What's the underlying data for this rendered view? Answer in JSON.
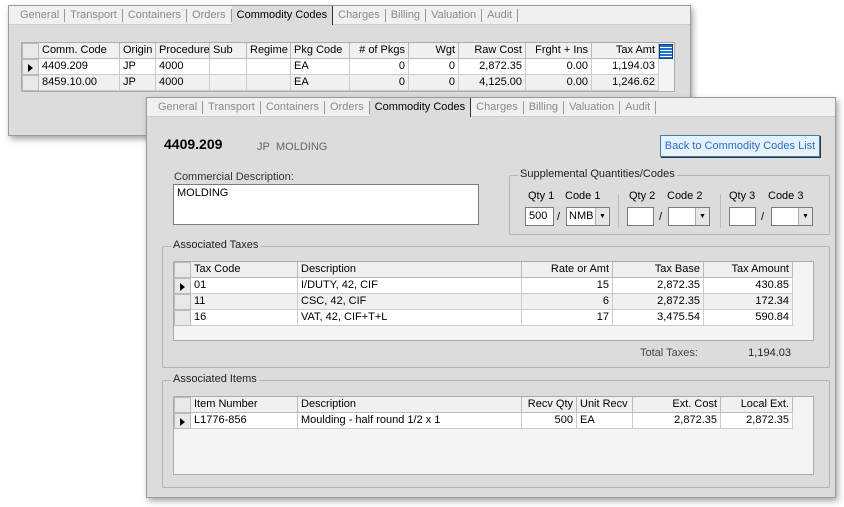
{
  "tabs": [
    "General",
    "Transport",
    "Containers",
    "Orders",
    "Commodity Codes",
    "Charges",
    "Billing",
    "Valuation",
    "Audit"
  ],
  "active_tab": "Commodity Codes",
  "list_grid": {
    "columns": [
      "Comm. Code",
      "Origin",
      "Procedure",
      "Sub",
      "Regime",
      "Pkg Code",
      "# of Pkgs",
      "Wgt",
      "Raw Cost",
      "Frght + Ins",
      "Tax Amt"
    ],
    "rows": [
      [
        "4409.209",
        "JP",
        "4000",
        "",
        "",
        "EA",
        "0",
        "0",
        "2,872.35",
        "0.00",
        "1,194.03"
      ],
      [
        "8459.10.00",
        "JP",
        "4000",
        "",
        "",
        "EA",
        "0",
        "0",
        "4,125.00",
        "0.00",
        "1,246.62"
      ]
    ],
    "menu_icon": "column-chooser-icon"
  },
  "detail": {
    "code": "4409.209",
    "origin": "JP",
    "name": "MOLDING",
    "back_button": "Back to Commodity Codes List",
    "commercial_description_label": "Commercial Description:",
    "commercial_description": "MOLDING",
    "supplemental": {
      "title": "Supplemental Quantities/Codes",
      "qty1_label": "Qty 1",
      "code1_label": "Code 1",
      "qty2_label": "Qty 2",
      "code2_label": "Code 2",
      "qty3_label": "Qty 3",
      "code3_label": "Code 3",
      "qty1": "500",
      "code1": "NMB",
      "qty2": "",
      "code2": "",
      "qty3": "",
      "code3": "",
      "sep": "/"
    },
    "taxes": {
      "title": "Associated Taxes",
      "columns": [
        "Tax Code",
        "Description",
        "Rate or Amt",
        "Tax Base",
        "Tax Amount"
      ],
      "rows": [
        [
          "01",
          "I/DUTY, 42, CIF",
          "15",
          "2,872.35",
          "430.85"
        ],
        [
          "11",
          "CSC, 42, CIF",
          "6",
          "2,872.35",
          "172.34"
        ],
        [
          "16",
          "VAT, 42, CIF+T+L",
          "17",
          "3,475.54",
          "590.84"
        ]
      ],
      "total_label": "Total Taxes:",
      "total": "1,194.03"
    },
    "items": {
      "title": "Associated Items",
      "columns": [
        "Item Number",
        "Description",
        "Recv Qty",
        "Unit Recv",
        "Ext. Cost",
        "Local Ext."
      ],
      "rows": [
        [
          "L1776-856",
          "Moulding - half round 1/2 x 1",
          "500",
          "EA",
          "2,872.35",
          "2,872.35"
        ]
      ]
    }
  }
}
